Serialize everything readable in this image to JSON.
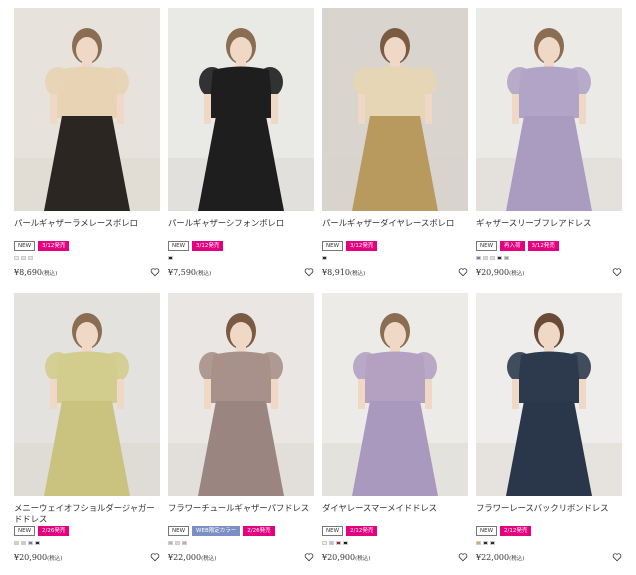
{
  "products": [
    {
      "name": "パールギャザーラメレースボレロ",
      "badges": [
        {
          "label": "NEW",
          "kind": "new"
        },
        {
          "label": "3/12発売",
          "kind": "date"
        }
      ],
      "swatches": [
        "#f3f0e8",
        "#d7e3f1",
        "#f1e7d2"
      ],
      "price": "¥8,690",
      "tax": "(税込)",
      "wall": "#e7e3dc",
      "dress": "#e8d3b4",
      "skirt": "#2c2622",
      "hair": "#8a6d52"
    },
    {
      "name": "パールギャザーシフォンボレロ",
      "badges": [
        {
          "label": "NEW",
          "kind": "new"
        },
        {
          "label": "3/12発売",
          "kind": "date"
        }
      ],
      "swatches": [
        "#222222"
      ],
      "price": "¥7,590",
      "tax": "(税込)",
      "wall": "#e9e9e6",
      "dress": "#1e1e1e",
      "skirt": "#1e1e1e",
      "hair": "#8a6d52"
    },
    {
      "name": "パールギャザーダイヤレースボレロ",
      "badges": [
        {
          "label": "NEW",
          "kind": "new"
        },
        {
          "label": "3/12発売",
          "kind": "date"
        }
      ],
      "swatches": [
        "#222222"
      ],
      "price": "¥8,910",
      "tax": "(税込)",
      "wall": "#d9d4ce",
      "dress": "#e6d6b5",
      "skirt": "#b99a5e",
      "hair": "#7a5b42"
    },
    {
      "name": "ギャザースリーブフレアドレス",
      "badges": [
        {
          "label": "NEW",
          "kind": "new"
        },
        {
          "label": "再入荷",
          "kind": "type"
        },
        {
          "label": "3/12発売",
          "kind": "date"
        }
      ],
      "swatches": [
        "#6c86b1",
        "#d9d9d9",
        "#e8e3d8",
        "#2b2b2b",
        "#b58a8a"
      ],
      "price": "¥20,900",
      "tax": "(税込)",
      "wall": "#eceae6",
      "dress": "#b1a4c6",
      "skirt": "#aa9cc0",
      "hair": "#8a6d52"
    },
    {
      "name": "メニーウェイオフショルダージャガードドレス",
      "badges": [
        {
          "label": "NEW",
          "kind": "new"
        },
        {
          "label": "2/26発売",
          "kind": "date"
        }
      ],
      "swatches": [
        "#d9d3a8",
        "#d7c8b6",
        "#6f7fa4",
        "#1f2a44"
      ],
      "price": "¥20,900",
      "tax": "(税込)",
      "wall": "#e4e2de",
      "dress": "#d2cd8c",
      "skirt": "#c9c37f",
      "hair": "#8a6d52"
    },
    {
      "name": "フラワーチュールギャザーパフドレス",
      "badges": [
        {
          "label": "NEW",
          "kind": "new"
        },
        {
          "label": "WEB限定カラー",
          "kind": "web"
        },
        {
          "label": "2/26発売",
          "kind": "date"
        }
      ],
      "swatches": [
        "#a6b6d6",
        "#e4d3c3",
        "#c9a6a6"
      ],
      "price": "¥22,000",
      "tax": "(税込)",
      "wall": "#e9e6e3",
      "dress": "#a8918a",
      "skirt": "#9a8580",
      "hair": "#7a5b42"
    },
    {
      "name": "ダイヤレースマーメイドドレス",
      "badges": [
        {
          "label": "NEW",
          "kind": "new"
        },
        {
          "label": "2/12発売",
          "kind": "date"
        }
      ],
      "swatches": [
        "#f1eee6",
        "#cdb9d3",
        "#9b2b2b",
        "#222222"
      ],
      "price": "¥20,900",
      "tax": "(税込)",
      "wall": "#ecebe8",
      "dress": "#b4a1c2",
      "skirt": "#a999bf",
      "hair": "#8a6d52"
    },
    {
      "name": "フラワーレースバックリボンドレス",
      "badges": [
        {
          "label": "NEW",
          "kind": "new"
        },
        {
          "label": "2/12発売",
          "kind": "date"
        }
      ],
      "swatches": [
        "#c4b06a",
        "#223044",
        "#2b2b2b"
      ],
      "price": "¥22,000",
      "tax": "(税込)",
      "wall": "#eeedeb",
      "dress": "#2d3a4e",
      "skirt": "#2a3649",
      "hair": "#6a4c36"
    }
  ]
}
